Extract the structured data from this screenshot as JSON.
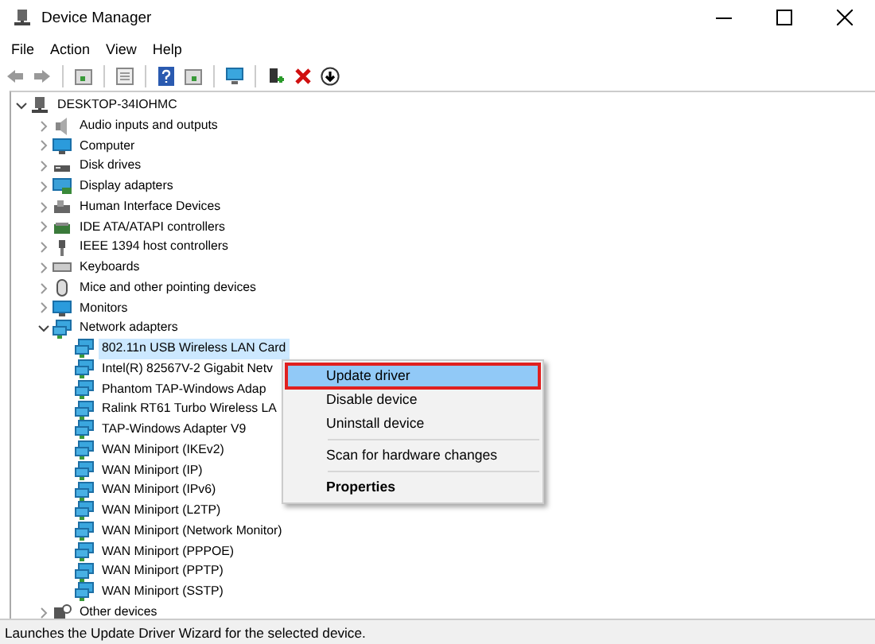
{
  "window": {
    "title": "Device Manager"
  },
  "menu_bar": [
    "File",
    "Action",
    "View",
    "Help"
  ],
  "tree": {
    "label": "DESKTOP-34IOHMC",
    "kind": "computer-root",
    "expanded": true,
    "selected": false,
    "children": [
      {
        "label": "Audio inputs and outputs",
        "kind": "audio",
        "expanded": false,
        "selected": false
      },
      {
        "label": "Computer",
        "kind": "monitor",
        "expanded": false,
        "selected": false
      },
      {
        "label": "Disk drives",
        "kind": "disk",
        "expanded": false,
        "selected": false
      },
      {
        "label": "Display adapters",
        "kind": "display",
        "expanded": false,
        "selected": false
      },
      {
        "label": "Human Interface Devices",
        "kind": "hid",
        "expanded": false,
        "selected": false
      },
      {
        "label": "IDE ATA/ATAPI controllers",
        "kind": "ide",
        "expanded": false,
        "selected": false
      },
      {
        "label": "IEEE 1394 host controllers",
        "kind": "plug",
        "expanded": false,
        "selected": false
      },
      {
        "label": "Keyboards",
        "kind": "keyboard",
        "expanded": false,
        "selected": false
      },
      {
        "label": "Mice and other pointing devices",
        "kind": "mouse",
        "expanded": false,
        "selected": false
      },
      {
        "label": "Monitors",
        "kind": "monitor",
        "expanded": false,
        "selected": false
      },
      {
        "label": "Network adapters",
        "kind": "network",
        "expanded": true,
        "selected": false,
        "children": [
          {
            "label": "802.11n USB Wireless LAN Card",
            "kind": "network",
            "selected": true
          },
          {
            "label": "Intel(R) 82567V-2 Gigabit Netv",
            "kind": "network",
            "selected": false
          },
          {
            "label": "Phantom TAP-Windows Adap",
            "kind": "network",
            "selected": false
          },
          {
            "label": "Ralink RT61 Turbo Wireless LA",
            "kind": "network",
            "selected": false
          },
          {
            "label": "TAP-Windows Adapter V9",
            "kind": "network",
            "selected": false
          },
          {
            "label": "WAN Miniport (IKEv2)",
            "kind": "network",
            "selected": false
          },
          {
            "label": "WAN Miniport (IP)",
            "kind": "network",
            "selected": false
          },
          {
            "label": "WAN Miniport (IPv6)",
            "kind": "network",
            "selected": false
          },
          {
            "label": "WAN Miniport (L2TP)",
            "kind": "network",
            "selected": false
          },
          {
            "label": "WAN Miniport (Network Monitor)",
            "kind": "network",
            "selected": false
          },
          {
            "label": "WAN Miniport (PPPOE)",
            "kind": "network",
            "selected": false
          },
          {
            "label": "WAN Miniport (PPTP)",
            "kind": "network",
            "selected": false
          },
          {
            "label": "WAN Miniport (SSTP)",
            "kind": "network",
            "selected": false
          }
        ]
      },
      {
        "label": "Other devices",
        "kind": "unknown",
        "expanded": false,
        "selected": false
      }
    ]
  },
  "context_menu": [
    {
      "label": "Update driver",
      "selected": true,
      "separator_before": false,
      "default": false
    },
    {
      "label": "Disable device",
      "selected": false,
      "separator_before": false,
      "default": false
    },
    {
      "label": "Uninstall device",
      "selected": false,
      "separator_before": false,
      "default": false
    },
    {
      "label": "Scan for hardware changes",
      "selected": false,
      "separator_before": true,
      "default": false
    },
    {
      "label": "Properties",
      "selected": false,
      "separator_before": true,
      "default": true
    }
  ],
  "status_bar": "Launches the Update Driver Wizard for the selected device."
}
